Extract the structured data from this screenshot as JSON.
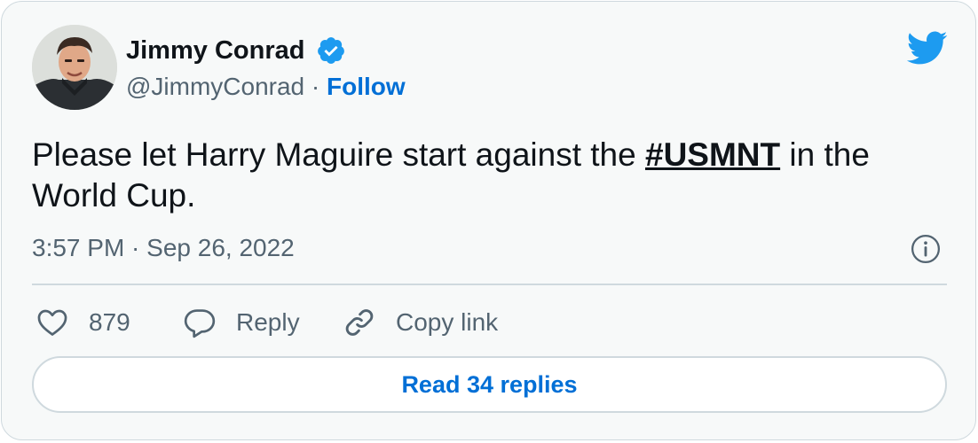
{
  "author": {
    "name": "Jimmy Conrad",
    "handle": "@JimmyConrad",
    "separator": " · ",
    "follow_label": "Follow",
    "verified": true
  },
  "tweet": {
    "text_before": "Please let Harry Maguire start against the ",
    "hashtag": "#USMNT",
    "text_after": " in the World Cup.",
    "timestamp": "3:57 PM · Sep 26, 2022"
  },
  "actions": {
    "like_count": "879",
    "reply_label": "Reply",
    "copy_link_label": "Copy link"
  },
  "read_replies_label": "Read 34 replies",
  "icons": {
    "brand": "twitter-bird-icon",
    "verified": "verified-badge-icon",
    "info": "info-icon",
    "like": "heart-icon",
    "reply": "speech-bubble-icon",
    "copy_link": "link-icon"
  },
  "colors": {
    "card_background": "#f7f9f9",
    "border": "#cfd9de",
    "text_primary": "#0f1419",
    "text_secondary": "#536471",
    "link_blue": "#006fd6",
    "twitter_blue": "#1d9bf0"
  }
}
